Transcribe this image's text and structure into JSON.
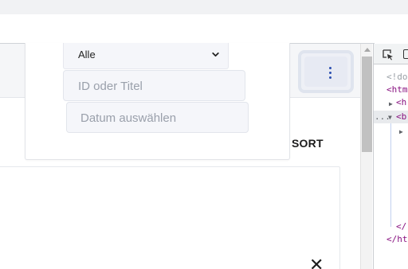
{
  "filter": {
    "status_select": {
      "value": "Alle"
    },
    "search_field": {
      "placeholder": "ID oder Titel"
    },
    "date_field": {
      "placeholder": "Datum auswählen"
    }
  },
  "list": {
    "sort_label": "SORT",
    "close_symbol": "✕"
  },
  "icons": {
    "chevron": "chevron-down-icon",
    "kebab": "kebab-menu-icon",
    "close": "close-icon",
    "inspect": "inspect-element-icon",
    "device": "device-toolbar-icon"
  },
  "colors": {
    "accent": "#2b4fb0",
    "field_bg": "#f5f6fa",
    "placeholder": "#9aa0ab",
    "header_bg": "#f5f6f8"
  },
  "devtools": {
    "lines": {
      "doctype": "<!do",
      "html_open": "<htm",
      "head": "<h",
      "body": "<b",
      "body_close": "</",
      "html_close": "</ht"
    },
    "collapsed_dots": "..."
  }
}
